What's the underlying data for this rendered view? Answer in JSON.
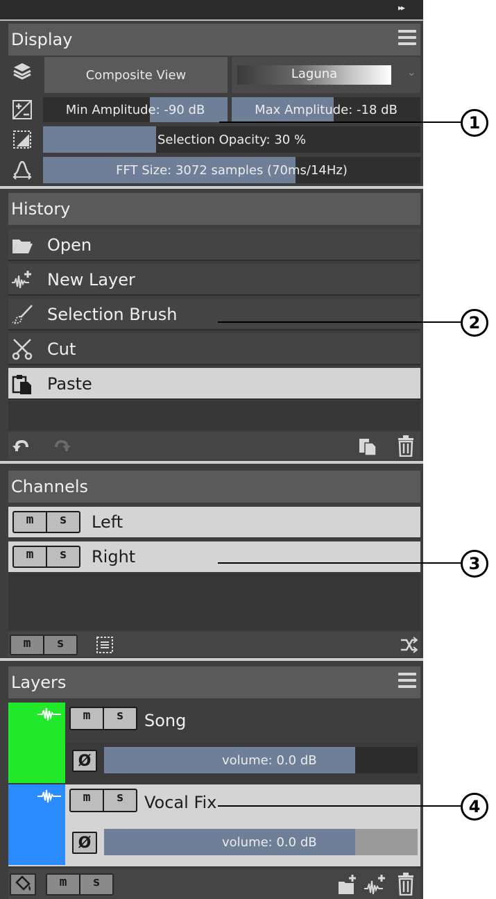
{
  "toolbar": {
    "collapse_glyph": "▸▸"
  },
  "display": {
    "title": "Display",
    "composite_label": "Composite View",
    "colormap_label": "Laguna",
    "min_amp_label": "Min Amplitude: -90 dB",
    "max_amp_label": "Max Amplitude: -18 dB",
    "selection_opacity_label": "Selection Opacity: 30 %",
    "fft_label": "FFT Size: 3072 samples (70ms/14Hz)",
    "min_amp_fraction": 0.42,
    "max_amp_fraction": 0.54,
    "selection_opacity_fraction": 0.3,
    "fft_fraction": 0.67
  },
  "history": {
    "title": "History",
    "items": [
      {
        "label": "Open",
        "icon": "folder-icon"
      },
      {
        "label": "New Layer",
        "icon": "new-layer-icon"
      },
      {
        "label": "Selection Brush",
        "icon": "brush-icon"
      },
      {
        "label": "Cut",
        "icon": "scissors-icon"
      },
      {
        "label": "Paste",
        "icon": "paste-icon",
        "selected": true
      }
    ]
  },
  "channels": {
    "title": "Channels",
    "mute": "m",
    "solo": "s",
    "items": [
      {
        "label": "Left"
      },
      {
        "label": "Right"
      }
    ]
  },
  "layers": {
    "title": "Layers",
    "mute": "m",
    "solo": "s",
    "phase": "Ø",
    "items": [
      {
        "name": "Song",
        "volume_label": "volume: 0.0 dB",
        "volume_fraction": 0.8,
        "color": "#22e82a"
      },
      {
        "name": "Vocal Fix",
        "volume_label": "volume: 0.0 dB",
        "volume_fraction": 0.8,
        "color": "#2a8cff"
      }
    ]
  },
  "callouts": [
    "1",
    "2",
    "3",
    "4"
  ],
  "colors": {
    "panel_bg": "#3e3e3e",
    "header_bg": "#5a5a5a",
    "slider_fill": "#6f7f97",
    "selected_row": "#d4d4d4"
  }
}
